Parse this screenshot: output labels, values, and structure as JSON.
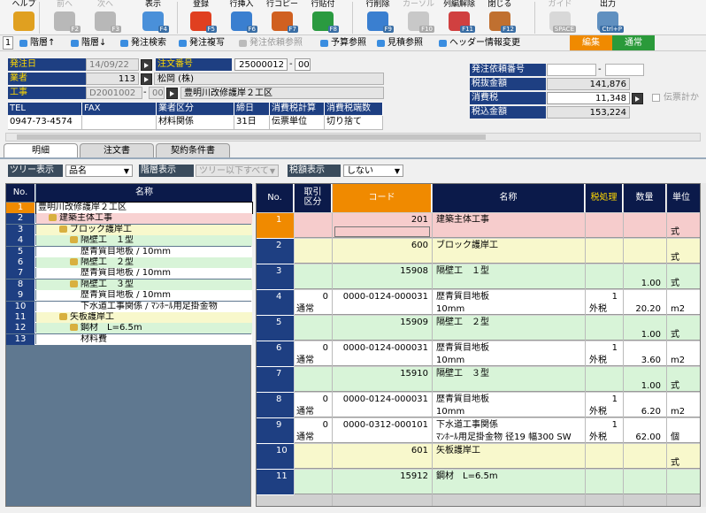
{
  "toolbar": {
    "items": [
      {
        "label": "ヘルプ",
        "fkey": "",
        "icon": "help-icon",
        "color": "#e0a020",
        "disabled": false
      },
      {
        "label": "前へ",
        "fkey": "F2",
        "icon": "prev-arrow-icon",
        "color": "#b8b8b8",
        "disabled": true
      },
      {
        "label": "次へ",
        "fkey": "F3",
        "icon": "next-arrow-icon",
        "color": "#b8b8b8",
        "disabled": true
      },
      {
        "label": "表示",
        "fkey": "F4",
        "icon": "magnifier-icon",
        "color": "#4a90d9",
        "disabled": false
      },
      {
        "label": "登録",
        "fkey": "F5",
        "icon": "ok-icon",
        "color": "#e04020",
        "disabled": false
      },
      {
        "label": "行挿入",
        "fkey": "F6",
        "icon": "row-insert-icon",
        "color": "#3a7fd0",
        "disabled": false
      },
      {
        "label": "行コピー",
        "fkey": "F7",
        "icon": "row-copy-icon",
        "color": "#d06020",
        "disabled": false
      },
      {
        "label": "行貼付",
        "fkey": "F8",
        "icon": "row-paste-icon",
        "color": "#2a9a40",
        "disabled": false
      },
      {
        "label": "行削除",
        "fkey": "F9",
        "icon": "row-delete-icon",
        "color": "#3a7fd0",
        "disabled": false
      },
      {
        "label": "カーソル",
        "fkey": "F10",
        "icon": "cursor-icon",
        "color": "#c8c8c8",
        "disabled": true
      },
      {
        "label": "列編解除",
        "fkey": "F11",
        "icon": "column-unlock-icon",
        "color": "#d04040",
        "disabled": false
      },
      {
        "label": "閉じる",
        "fkey": "F12",
        "icon": "close-door-icon",
        "color": "#c07030",
        "disabled": false
      },
      {
        "label": "ガイド",
        "fkey": "SPACE",
        "icon": "guide-bulb-icon",
        "color": "#d8d8d8",
        "disabled": true
      },
      {
        "label": "出力",
        "fkey": "Ctrl+P",
        "icon": "printer-icon",
        "color": "#6090c0",
        "disabled": false
      }
    ]
  },
  "secondary": {
    "page": "1",
    "items": [
      {
        "label": "階層↑",
        "disabled": false
      },
      {
        "label": "階層↓",
        "disabled": false
      },
      {
        "label": "発注検索",
        "disabled": false
      },
      {
        "label": "発注複写",
        "disabled": false
      },
      {
        "label": "発注依頼参照",
        "disabled": true
      },
      {
        "label": "予算参照",
        "disabled": false
      },
      {
        "label": "見積参照",
        "disabled": false
      },
      {
        "label": "ヘッダー情報変更",
        "disabled": false
      }
    ],
    "mode_edit": "編集",
    "mode_normal": "通常"
  },
  "header": {
    "order_date_label": "発注日",
    "order_date": "14/09/22",
    "order_no_label": "注文番号",
    "order_no": "25000012",
    "order_no_sub": "00",
    "vendor_label": "業者",
    "vendor_code": "113",
    "vendor_name": "松岡 (株)",
    "project_label": "工事",
    "project_code": "D2001002",
    "project_sub": "00",
    "project_name": "豊明川改修護岸２工区",
    "tel_label": "TEL",
    "tel": "0947-73-4574",
    "fax_label": "FAX",
    "fax": "",
    "category_label": "業者区分",
    "category": "材料関係",
    "closing_label": "締日",
    "closing": "31日",
    "tax_calc_label": "消費税計算",
    "tax_calc": "伝票単位",
    "tax_round_label": "消費税端数",
    "tax_round": "切り捨て",
    "request_no_label": "発注依頼番号",
    "request_no": "",
    "request_no_sub": "",
    "excl_label": "税抜金額",
    "excl": "141,876",
    "tax_label": "消費税",
    "tax": "11,348",
    "incl_label": "税込金額",
    "incl": "153,224",
    "slip_calc_label": "伝票計か"
  },
  "tabs": [
    "明細",
    "注文書",
    "契約条件書"
  ],
  "filters": {
    "tree_label": "ツリー表示",
    "tree_value": "品名",
    "level_label": "階層表示",
    "level_value": "ツリー以下すべて",
    "tax_label": "税額表示",
    "tax_value": "しない"
  },
  "tree": {
    "col_no": "No.",
    "col_name": "名称",
    "rows": [
      {
        "no": "1",
        "name": "豊明川改修護岸２工区",
        "depth": 0,
        "bg": "#ffffff",
        "sel": true,
        "icon": false
      },
      {
        "no": "2",
        "name": "建築主体工事",
        "depth": 1,
        "bg": "#f8d2d2",
        "sel": false,
        "icon": true
      },
      {
        "no": "3",
        "name": "ブロック護岸工",
        "depth": 2,
        "bg": "#f8f8cc",
        "sel": false,
        "icon": true
      },
      {
        "no": "4",
        "name": "隔壁工　１型",
        "depth": 3,
        "bg": "#d8f4d8",
        "sel": false,
        "icon": true
      },
      {
        "no": "5",
        "name": "歴青質目地板 / 10mm",
        "depth": 4,
        "bg": "#ffffff",
        "sel": false,
        "icon": false
      },
      {
        "no": "6",
        "name": "隔壁工　２型",
        "depth": 3,
        "bg": "#d8f4d8",
        "sel": false,
        "icon": true
      },
      {
        "no": "7",
        "name": "歴青質目地板 / 10mm",
        "depth": 4,
        "bg": "#ffffff",
        "sel": false,
        "icon": false
      },
      {
        "no": "8",
        "name": "隔壁工　３型",
        "depth": 3,
        "bg": "#d8f4d8",
        "sel": false,
        "icon": true
      },
      {
        "no": "9",
        "name": "歴青質目地板 / 10mm",
        "depth": 4,
        "bg": "#ffffff",
        "sel": false,
        "icon": false
      },
      {
        "no": "10",
        "name": "下水道工事関係 / ﾏﾝﾎｰﾙ用足掛金物",
        "depth": 4,
        "bg": "#ffffff",
        "sel": false,
        "icon": false
      },
      {
        "no": "11",
        "name": "矢板護岸工",
        "depth": 2,
        "bg": "#f8f8cc",
        "sel": false,
        "icon": true
      },
      {
        "no": "12",
        "name": "鋼材　L=6.5m",
        "depth": 3,
        "bg": "#d8f4d8",
        "sel": false,
        "icon": true
      },
      {
        "no": "13",
        "name": "材料費",
        "depth": 4,
        "bg": "#ffffff",
        "sel": false,
        "icon": false
      }
    ]
  },
  "grid": {
    "col_no": "No.",
    "col_kind": "取引\n区分",
    "col_code": "コード",
    "col_name": "名称",
    "col_tax": "税処理",
    "col_qty": "数量",
    "col_unit": "単位",
    "rows": [
      {
        "no": "1",
        "kind_a": "",
        "kind_b": "",
        "code": "201",
        "code2": "",
        "name": "建築主体工事",
        "name2": "",
        "tax_a": "",
        "tax_b": "",
        "qty": "",
        "unit": "式",
        "bg": "#f6cccc",
        "sel": true
      },
      {
        "no": "2",
        "kind_a": "",
        "kind_b": "",
        "code": "600",
        "code2": "",
        "name": "ブロック護岸工",
        "name2": "",
        "tax_a": "",
        "tax_b": "",
        "qty": "",
        "unit": "式",
        "bg": "#f8f8cc",
        "sel": false
      },
      {
        "no": "3",
        "kind_a": "",
        "kind_b": "",
        "code": "15908",
        "code2": "",
        "name": "隔壁工　１型",
        "name2": "",
        "tax_a": "",
        "tax_b": "",
        "qty": "1.00",
        "unit": "式",
        "bg": "#d8f4d8",
        "sel": false
      },
      {
        "no": "4",
        "kind_a": "0",
        "kind_b": "通常",
        "code": "0000-0124-000031",
        "code2": "",
        "name": "歴青質目地板",
        "name2": "10mm",
        "tax_a": "1",
        "tax_b": "外税",
        "qty": "20.20",
        "unit": "m2",
        "bg": "#ffffff",
        "sel": false
      },
      {
        "no": "5",
        "kind_a": "",
        "kind_b": "",
        "code": "15909",
        "code2": "",
        "name": "隔壁工　２型",
        "name2": "",
        "tax_a": "",
        "tax_b": "",
        "qty": "1.00",
        "unit": "式",
        "bg": "#d8f4d8",
        "sel": false
      },
      {
        "no": "6",
        "kind_a": "0",
        "kind_b": "通常",
        "code": "0000-0124-000031",
        "code2": "",
        "name": "歴青質目地板",
        "name2": "10mm",
        "tax_a": "1",
        "tax_b": "外税",
        "qty": "3.60",
        "unit": "m2",
        "bg": "#ffffff",
        "sel": false
      },
      {
        "no": "7",
        "kind_a": "",
        "kind_b": "",
        "code": "15910",
        "code2": "",
        "name": "隔壁工　３型",
        "name2": "",
        "tax_a": "",
        "tax_b": "",
        "qty": "1.00",
        "unit": "式",
        "bg": "#d8f4d8",
        "sel": false
      },
      {
        "no": "8",
        "kind_a": "0",
        "kind_b": "通常",
        "code": "0000-0124-000031",
        "code2": "",
        "name": "歴青質目地板",
        "name2": "10mm",
        "tax_a": "1",
        "tax_b": "外税",
        "qty": "6.20",
        "unit": "m2",
        "bg": "#ffffff",
        "sel": false
      },
      {
        "no": "9",
        "kind_a": "0",
        "kind_b": "通常",
        "code": "0000-0312-000101",
        "code2": "",
        "name": "下水道工事関係",
        "name2": "ﾏﾝﾎｰﾙ用足掛金物 径19 幅300 SW",
        "tax_a": "1",
        "tax_b": "外税",
        "qty": "62.00",
        "unit": "個",
        "bg": "#ffffff",
        "sel": false
      },
      {
        "no": "10",
        "kind_a": "",
        "kind_b": "",
        "code": "601",
        "code2": "",
        "name": "矢板護岸工",
        "name2": "",
        "tax_a": "",
        "tax_b": "",
        "qty": "",
        "unit": "式",
        "bg": "#f8f8cc",
        "sel": false
      },
      {
        "no": "11",
        "kind_a": "",
        "kind_b": "",
        "code": "15912",
        "code2": "",
        "name": "鋼材　L=6.5m",
        "name2": "",
        "tax_a": "",
        "tax_b": "",
        "qty": "",
        "unit": "",
        "bg": "#d8f4d8",
        "sel": false
      }
    ]
  }
}
